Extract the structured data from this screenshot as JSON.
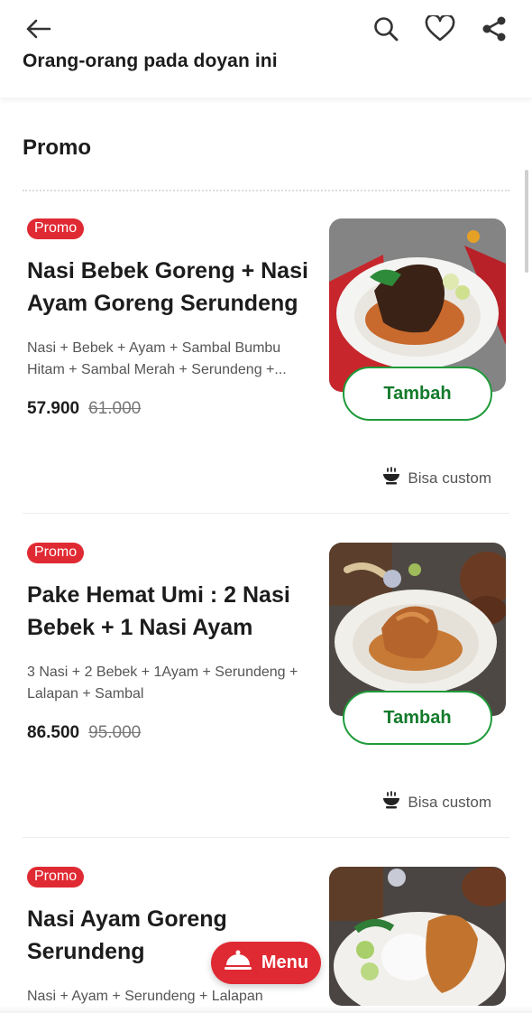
{
  "header": {
    "section_peek": "Orang-orang pada doyan ini",
    "icons": [
      "back-arrow-icon",
      "search-icon",
      "heart-icon",
      "share-icon"
    ]
  },
  "section": {
    "title": "Promo"
  },
  "items": [
    {
      "badge": "Promo",
      "name": "Nasi Bebek Goreng + Nasi Ayam Goreng Serundeng",
      "desc": "Nasi + Bebek + Ayam + Sambal Bumbu Hitam + Sambal Merah + Serundeng +...",
      "price": "57.900",
      "old_price": "61.000",
      "button": "Tambah",
      "custom": "Bisa custom"
    },
    {
      "badge": "Promo",
      "name": "Pake Hemat Umi : 2 Nasi Bebek + 1 Nasi Ayam",
      "desc": "3 Nasi + 2 Bebek + 1Ayam + Serundeng + Lalapan + Sambal",
      "price": "86.500",
      "old_price": "95.000",
      "button": "Tambah",
      "custom": "Bisa custom"
    },
    {
      "badge": "Promo",
      "name": "Nasi Ayam Goreng Serundeng",
      "desc": "Nasi + Ayam + Serundeng + Lalapan"
    }
  ],
  "fab": {
    "label": "Menu"
  },
  "colors": {
    "promo_red": "#e02a33",
    "green": "#1f9b3a"
  }
}
